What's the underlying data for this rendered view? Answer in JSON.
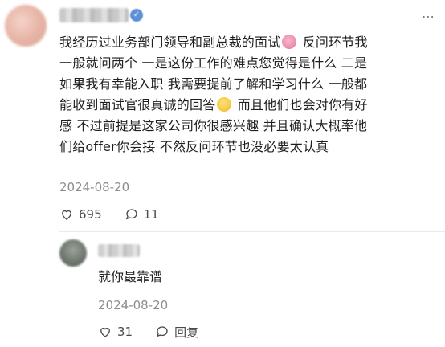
{
  "post": {
    "content_lines": [
      "我经历过业务部门领导和副总裁的面试",
      "反问环节我",
      "一般就问两个 一是这份工作的难点您觉得是什么 二是",
      "如果我有幸能入职 我需要提前了解和学习什么 一般都",
      "能收到面试官很真诚的回答",
      "而且他们也会对你有好",
      "感 不过前提是这家公司你很感兴趣 并且确认大概率他",
      "们给offer你会接 不然反问环节也没必要太认真"
    ],
    "date": "2024-08-20",
    "likes": "695",
    "comments": "11",
    "icons": {
      "emoji_1": "blushing-face-emoji-icon",
      "emoji_2": "smiling-face-emoji-icon",
      "like": "heart-icon",
      "comment": "comment-bubble-icon",
      "more": "more-options-icon",
      "verified": "verified-badge-icon"
    }
  },
  "reply": {
    "text": "就你最靠谱",
    "date": "2024-08-20",
    "likes": "31",
    "reply_label": "回复",
    "icons": {
      "like": "heart-icon",
      "reply": "comment-bubble-icon"
    }
  }
}
